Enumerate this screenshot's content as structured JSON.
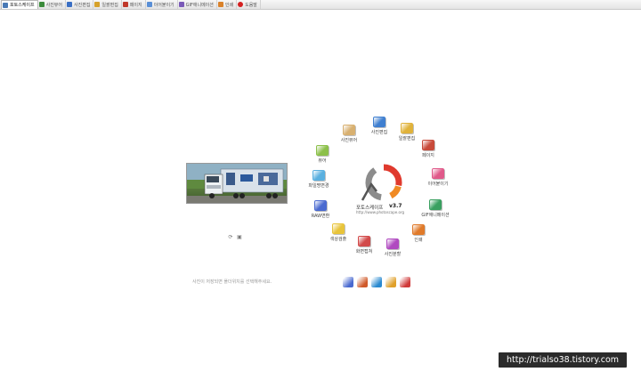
{
  "tabs": [
    {
      "label": "포토스케이프",
      "icon": "photoscape-icon",
      "color": "#4a7ab5",
      "active": true
    },
    {
      "label": "사진뷰어",
      "icon": "viewer-icon",
      "color": "#3b8b3b"
    },
    {
      "label": "사진편집",
      "icon": "editor-icon",
      "color": "#3a6fc4"
    },
    {
      "label": "일괄편집",
      "icon": "batch-icon",
      "color": "#d6a12a"
    },
    {
      "label": "페이지",
      "icon": "page-icon",
      "color": "#c0392b"
    },
    {
      "label": "이어붙이기",
      "icon": "combine-icon",
      "color": "#5a8fd6"
    },
    {
      "label": "GIF애니메이션",
      "icon": "gif-icon",
      "color": "#7a5ab8"
    },
    {
      "label": "인쇄",
      "icon": "print-icon",
      "color": "#d9822b"
    },
    {
      "label": "도움말",
      "icon": "help-icon",
      "color": "#d42020"
    }
  ],
  "left_panel": {
    "controls": [
      "⟳",
      "▣"
    ],
    "status_text": "사진이 저장되면 폴더위치를 선택해주세요."
  },
  "logo": {
    "title": "포토스케이프",
    "version": "v3.7",
    "url": "http://www.photoscape.org",
    "colors": {
      "red": "#e03a2e",
      "orange": "#f08a24",
      "gray": "#8c8c8c",
      "dark": "#555555"
    }
  },
  "ring_menu": [
    {
      "key": "editor",
      "label": "사진편집",
      "color": "#3f7fd0"
    },
    {
      "key": "batch",
      "label": "일괄편집",
      "color": "#e0b23a"
    },
    {
      "key": "page",
      "label": "페이지",
      "color": "#c84a3a"
    },
    {
      "key": "combine",
      "label": "이어붙이기",
      "color": "#e05a8a"
    },
    {
      "key": "gif",
      "label": "GIF애니메이션",
      "color": "#3aa060"
    },
    {
      "key": "print",
      "label": "인쇄",
      "color": "#e07a2a"
    },
    {
      "key": "splitter",
      "label": "사진분할",
      "color": "#b04ac0"
    },
    {
      "key": "capture",
      "label": "화면캡쳐",
      "color": "#d24a4a"
    },
    {
      "key": "colorpicker",
      "label": "색상검출",
      "color": "#e8c43a"
    },
    {
      "key": "rename",
      "label": "RAW변환",
      "color": "#4a6ad0"
    },
    {
      "key": "frame",
      "label": "파일명변경",
      "color": "#5ab0e0"
    },
    {
      "key": "viewer",
      "label": "뷰어",
      "color": "#8cc04a"
    },
    {
      "key": "collage",
      "label": "사진뷰어",
      "color": "#d8b070"
    }
  ],
  "tools": [
    {
      "icon": "font-icon",
      "color": "#4a6ad0"
    },
    {
      "icon": "magnifier-icon",
      "color": "#d05a2a"
    },
    {
      "icon": "paper-icon",
      "color": "#2a8ad0"
    },
    {
      "icon": "color-icon",
      "color": "#e0a02a"
    },
    {
      "icon": "brush-icon",
      "color": "#d03a3a"
    }
  ],
  "watermark": "http://trialso38.tistory.com"
}
